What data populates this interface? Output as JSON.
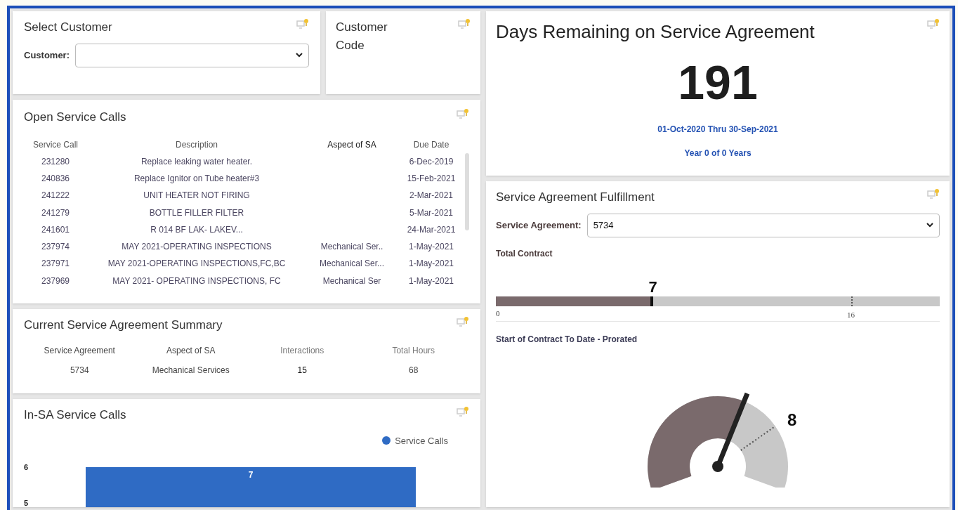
{
  "select_customer": {
    "title": "Select Customer",
    "label": "Customer:"
  },
  "customer_code": {
    "title": "Customer Code"
  },
  "open_service_calls": {
    "title": "Open Service Calls",
    "columns": [
      "Service Call",
      "Description",
      "Aspect of SA",
      "Due Date"
    ],
    "rows": [
      [
        "231280",
        "Replace leaking water heater.",
        "",
        "6-Dec-2019"
      ],
      [
        "240836",
        "Replace Ignitor on Tube heater#3",
        "",
        "15-Feb-2021"
      ],
      [
        "241222",
        "UNIT HEATER NOT FIRING",
        "",
        "2-Mar-2021"
      ],
      [
        "241279",
        "BOTTLE FILLER FILTER",
        "",
        "5-Mar-2021"
      ],
      [
        "241601",
        "R 014 BF LAK- LAKEV...",
        "",
        "24-Mar-2021"
      ],
      [
        "237974",
        "MAY 2021-OPERATING INSPECTIONS",
        "Mechanical Ser..",
        "1-May-2021"
      ],
      [
        "237971",
        "MAY 2021-OPERATING INSPECTIONS,FC,BC",
        "Mechanical Ser...",
        "1-May-2021"
      ],
      [
        "237969",
        "MAY 2021- OPERATING INSPECTIONS, FC",
        "Mechanical Ser",
        "1-May-2021"
      ]
    ]
  },
  "summary": {
    "title": "Current Service Agreement Summary",
    "columns": [
      "Service Agreement",
      "Aspect of SA",
      "Interactions",
      "Total Hours"
    ],
    "values": [
      "5734",
      "Mechanical Services",
      "15",
      "68"
    ]
  },
  "in_sa": {
    "title": "In-SA Service Calls",
    "legend": "Service Calls",
    "axis_labels": [
      "6",
      "5"
    ],
    "bar_label": "7"
  },
  "days_remaining": {
    "title": "Days Remaining on Service Agreement",
    "value": "191",
    "period": "01-Oct-2020 Thru 30-Sep-2021",
    "year": "Year 0 of 0 Years"
  },
  "fulfillment": {
    "title": "Service Agreement Fulfillment",
    "label": "Service Agreement:",
    "value": "5734",
    "total": {
      "title": "Total Contract",
      "reading": "7",
      "level": 0.354,
      "min": "0",
      "target": "16"
    },
    "prorated": {
      "title": "Start of Contract To Date - Prorated",
      "target": "8"
    }
  }
}
